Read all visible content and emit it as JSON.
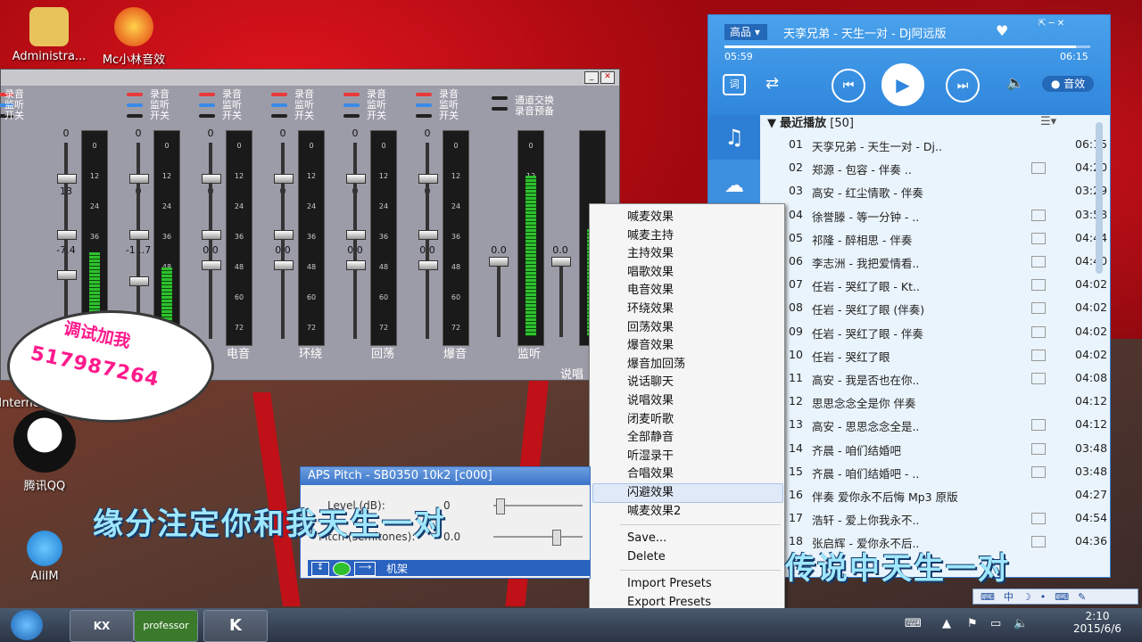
{
  "desktop": {
    "icons": [
      "Administra...",
      "Mc小林音效",
      "Internet Expl",
      "腾讯QQ",
      "AliIM"
    ]
  },
  "bubble": {
    "line1": "调试加我",
    "line2": "517987264"
  },
  "mixer": {
    "header_labels": [
      "录音",
      "监听",
      "开关"
    ],
    "extra_labels": [
      "通道交换",
      "录音预备"
    ],
    "channels": [
      {
        "v1": "0",
        "v2": "13",
        "v3": "-7.4",
        "name": ""
      },
      {
        "v1": "0",
        "v2": "0",
        "v3": "-11.7",
        "name": ""
      },
      {
        "v1": "0",
        "v2": "0",
        "v3": "0.0",
        "name": "电音"
      },
      {
        "v1": "0",
        "v2": "0",
        "v3": "0.0",
        "name": "环绕"
      },
      {
        "v1": "0",
        "v2": "0",
        "v3": "0.0",
        "name": "回荡"
      },
      {
        "v1": "0",
        "v2": "0",
        "v3": "0.0",
        "name": "爆音"
      }
    ],
    "monitor": {
      "v": "0.0",
      "v2": "0.0",
      "name": "监听"
    },
    "footer": "说唱",
    "scale": [
      "0",
      "12",
      "24",
      "36",
      "48",
      "60",
      "72"
    ],
    "meter_levels": [
      0.55,
      0.45,
      0.0,
      0.0,
      0.0,
      0.0,
      0.9,
      0.6
    ]
  },
  "menu": {
    "items": [
      "喊麦效果",
      "喊麦主持",
      "主持效果",
      "唱歌效果",
      "电音效果",
      "环绕效果",
      "回荡效果",
      "爆音效果",
      "爆音加回荡",
      "说话聊天",
      "说唱效果",
      "闭麦听歌",
      "全部静音",
      "听湿录干",
      "合唱效果",
      "闪避效果",
      "喊麦效果2"
    ],
    "highlighted_index": 15,
    "actions": [
      "Save...",
      "Delete"
    ],
    "presets": [
      "Import Presets",
      "Export Presets"
    ]
  },
  "player": {
    "quality": "高品",
    "now_playing": "天孪兄弟 - 天生一对 - Dj阿远版",
    "elapsed": "05:59",
    "total": "06:15",
    "progress": 0.96,
    "effect_label": "音效",
    "lyric_icon": "词",
    "list_title": "最近播放",
    "list_count": "[50]",
    "tracks": [
      {
        "n": "01",
        "t": "天孪兄弟 - 天生一对 - Dj..",
        "d": "06:15",
        "mv": false
      },
      {
        "n": "02",
        "t": "郑源 - 包容 - 伴奏 ..",
        "d": "04:20",
        "mv": true
      },
      {
        "n": "03",
        "t": "高安 - 红尘情歌 - 伴奏",
        "d": "03:29",
        "mv": false
      },
      {
        "n": "04",
        "t": "徐誉滕 - 等一分钟 - ..",
        "d": "03:58",
        "mv": true
      },
      {
        "n": "05",
        "t": "祁隆 - 醉相思 - 伴奏",
        "d": "04:44",
        "mv": true
      },
      {
        "n": "06",
        "t": "李志洲 - 我把爱情看..",
        "d": "04:40",
        "mv": true
      },
      {
        "n": "07",
        "t": "任岩 - 哭红了眼 - Kt..",
        "d": "04:02",
        "mv": true
      },
      {
        "n": "08",
        "t": "任岩 - 哭红了眼 (伴奏)",
        "d": "04:02",
        "mv": true
      },
      {
        "n": "09",
        "t": "任岩 - 哭红了眼 - 伴奏",
        "d": "04:02",
        "mv": true
      },
      {
        "n": "10",
        "t": "任岩 - 哭红了眼",
        "d": "04:02",
        "mv": true
      },
      {
        "n": "11",
        "t": "高安 - 我是否也在你..",
        "d": "04:08",
        "mv": true
      },
      {
        "n": "12",
        "t": "思思念念全是你 伴奏",
        "d": "04:12",
        "mv": false
      },
      {
        "n": "13",
        "t": "高安 - 思思念念全是..",
        "d": "04:12",
        "mv": true
      },
      {
        "n": "14",
        "t": "齐晨 - 咱们结婚吧",
        "d": "03:48",
        "mv": true
      },
      {
        "n": "15",
        "t": "齐晨 - 咱们结婚吧 - ..",
        "d": "03:48",
        "mv": true
      },
      {
        "n": "16",
        "t": "伴奏 爱你永不后悔 Mp3 原版",
        "d": "04:27",
        "mv": false
      },
      {
        "n": "17",
        "t": "浩轩 - 爱上你我永不..",
        "d": "04:54",
        "mv": true
      },
      {
        "n": "18",
        "t": "张启辉 - 爱你永不后..",
        "d": "04:36",
        "mv": true
      }
    ]
  },
  "pitch": {
    "title": "APS Pitch - SB0350 10k2 [c000]",
    "level_label": "Level (dB):",
    "level_value": "0",
    "pitch_label": "Pitch (semitones):",
    "pitch_value": "0.0",
    "preset": "机架"
  },
  "lyrics": {
    "left": "缘分注定你和我天生一对",
    "right": "传说中天生一对"
  },
  "taskbar": {
    "time": "2:10",
    "date": "2015/6/6",
    "apps": [
      "KX",
      "professor",
      "K"
    ]
  },
  "tray_icons": [
    "keyboard-icon",
    "中",
    "moon-icon",
    "dot-icon",
    "keyboard-icon",
    "wrench-icon"
  ]
}
